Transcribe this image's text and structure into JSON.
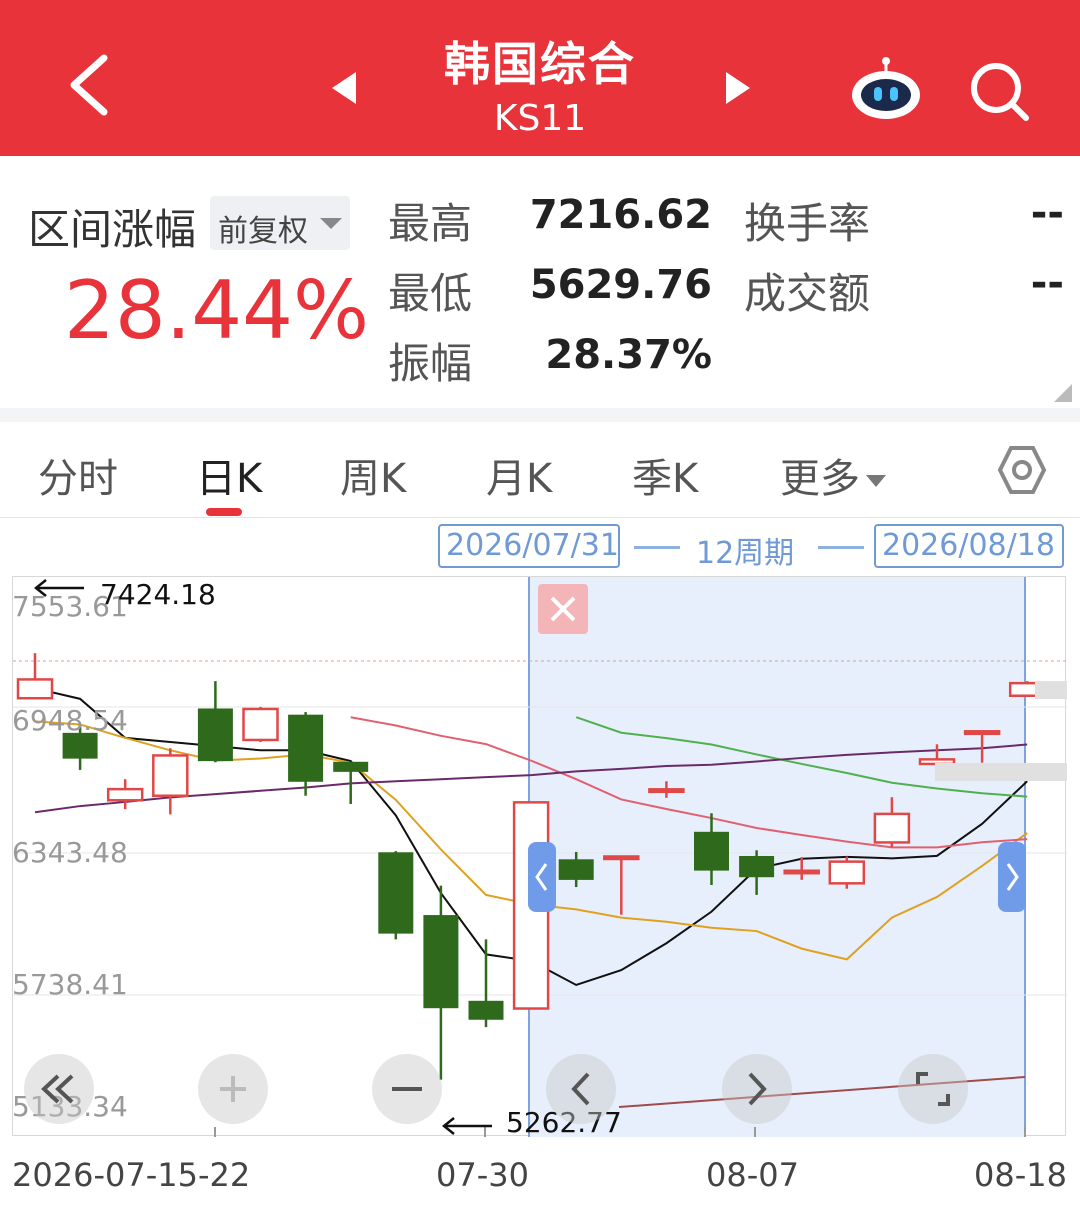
{
  "header": {
    "title": "韩国综合",
    "code": "KS11"
  },
  "stats": {
    "range_label": "区间涨幅",
    "adjust_label": "前复权",
    "range_pct": "28.44%",
    "high_label": "最高",
    "high_value": "7216.62",
    "low_label": "最低",
    "low_value": "5629.76",
    "amp_label": "振幅",
    "amp_value": "28.37%",
    "turnover_label": "换手率",
    "turnover_value": "--",
    "volume_label": "成交额",
    "volume_value": "--"
  },
  "tabs": [
    {
      "label": "分时"
    },
    {
      "label": "日K"
    },
    {
      "label": "周K"
    },
    {
      "label": "月K"
    },
    {
      "label": "季K"
    },
    {
      "label": "更多"
    }
  ],
  "period": {
    "start": "2026/07/31",
    "label": "12周期",
    "end": "2026/08/18"
  },
  "chart_data": {
    "type": "candlestick",
    "y_ticks": [
      "7553.61",
      "6948.54",
      "6343.48",
      "5738.41",
      "5133.34"
    ],
    "x_ticks": [
      "2026-07-15-22",
      "07-30",
      "08-07",
      "08-18"
    ],
    "max_marker": "7424.18",
    "min_marker": "5262.77",
    "candles": [
      {
        "o": 7112,
        "c": 7203,
        "h": 7330,
        "l": 7110
      },
      {
        "o": 6942,
        "c": 6822,
        "h": 6980,
        "l": 6765
      },
      {
        "o": 6618,
        "c": 6672,
        "h": 6720,
        "l": 6575
      },
      {
        "o": 6640,
        "c": 6835,
        "h": 6870,
        "l": 6550
      },
      {
        "o": 7060,
        "c": 6810,
        "h": 7195,
        "l": 6802
      },
      {
        "o": 6910,
        "c": 7060,
        "h": 7070,
        "l": 6900
      },
      {
        "o": 7030,
        "c": 6710,
        "h": 7045,
        "l": 6640
      },
      {
        "o": 6802,
        "c": 6758,
        "h": 6805,
        "l": 6600
      },
      {
        "o": 6364,
        "c": 5975,
        "h": 6372,
        "l": 5945
      },
      {
        "o": 6060,
        "c": 5614,
        "h": 6205,
        "l": 5265
      },
      {
        "o": 5645,
        "c": 5558,
        "h": 5945,
        "l": 5520
      },
      {
        "o": 5610,
        "c": 6608,
        "h": 6610,
        "l": 5610
      },
      {
        "o": 6330,
        "c": 6235,
        "h": 6368,
        "l": 6198
      },
      {
        "o": 6346,
        "c": 6346,
        "h": 6346,
        "l": 6064
      },
      {
        "o": 6671,
        "c": 6671,
        "h": 6710,
        "l": 6630
      },
      {
        "o": 6463,
        "c": 6280,
        "h": 6555,
        "l": 6208
      },
      {
        "o": 6346,
        "c": 6248,
        "h": 6376,
        "l": 6160
      },
      {
        "o": 6277,
        "c": 6277,
        "h": 6343,
        "l": 6233
      },
      {
        "o": 6216,
        "c": 6321,
        "h": 6346,
        "l": 6190
      },
      {
        "o": 6414,
        "c": 6552,
        "h": 6633,
        "l": 6390
      },
      {
        "o": 6794,
        "c": 6816,
        "h": 6889,
        "l": 6780
      },
      {
        "o": 6952,
        "c": 6952,
        "h": 6950,
        "l": 6800
      },
      {
        "o": 7124,
        "c": 7185,
        "h": 7195,
        "l": 7124
      }
    ],
    "ma": [
      {
        "color": "#111111",
        "values": [
          7160,
          7109,
          6920,
          6900,
          6880,
          6860,
          6860,
          6808,
          6545,
          6169,
          5872,
          5840,
          5724,
          5796,
          5926,
          6079,
          6287,
          6335,
          6344,
          6337,
          6349,
          6504,
          6710
        ]
      },
      {
        "color": "#e0a020",
        "values": [
          7000,
          6985,
          6920,
          6860,
          6810,
          6820,
          6840,
          6800,
          6620,
          6380,
          6160,
          6114,
          6090,
          6050,
          6030,
          6001,
          5985,
          5900,
          5848,
          6050,
          6150,
          6300,
          6460
        ]
      },
      {
        "color": "#e06070",
        "values": [
          null,
          null,
          null,
          null,
          null,
          null,
          null,
          7020,
          6980,
          6930,
          6890,
          6810,
          6720,
          6622,
          6576,
          6532,
          6484,
          6450,
          6418,
          6390,
          6390,
          6415,
          6430
        ]
      },
      {
        "color": "#50b050",
        "values": [
          null,
          null,
          null,
          null,
          null,
          null,
          null,
          null,
          null,
          null,
          null,
          null,
          7020,
          6945,
          6919,
          6888,
          6840,
          6794,
          6750,
          6703,
          6675,
          6652,
          6636
        ]
      },
      {
        "color": "#6a2a6a",
        "values": [
          6560,
          6590,
          6610,
          6632,
          6648,
          6664,
          6680,
          6700,
          6710,
          6720,
          6730,
          6740,
          6758,
          6770,
          6784,
          6790,
          6806,
          6823,
          6838,
          6850,
          6860,
          6870,
          6888
        ]
      }
    ]
  },
  "controls": {
    "zoom_out": "−",
    "zoom_in": "+"
  }
}
